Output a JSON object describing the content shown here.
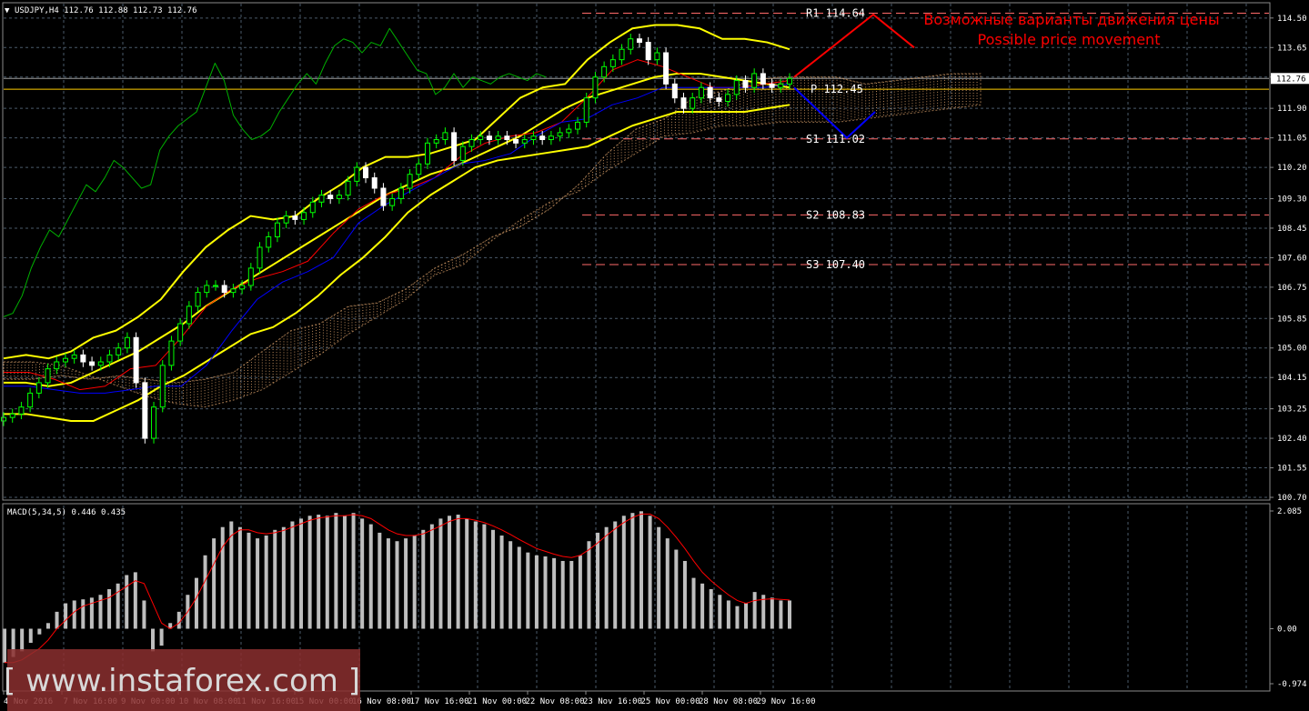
{
  "header": {
    "symbol_line": "USDJPY,H4  112.76 112.88 112.73 112.76",
    "macd_line": "MACD(5,34,5) 0.446 0.435"
  },
  "colors": {
    "background": "#000000",
    "grid": "#4a5a6a",
    "bull": "#00ff00",
    "bear": "#ffffff",
    "bollinger": "#ffff00",
    "tenkan": "#ff0000",
    "kijun": "#0000ff",
    "chikou": "#00b000",
    "cloud": "#d9a06a",
    "pivot": "#ffcc00",
    "levels": "#ff6a6a",
    "macd_hist": "#bebebe",
    "macd_signal": "#ff0000",
    "watermark_bg": "#8b2f2f"
  },
  "watermark": {
    "text": "[ www.instaforex.com ]"
  },
  "chart_data": [
    {
      "type": "candlestick",
      "symbol": "USDJPY",
      "timeframe": "H4",
      "ylim": [
        100.7,
        114.6
      ],
      "yticks": [
        "114.50",
        "113.65",
        "112.80",
        "111.90",
        "111.05",
        "110.20",
        "109.30",
        "108.45",
        "107.60",
        "106.75",
        "105.85",
        "105.00",
        "104.15",
        "103.25",
        "102.40",
        "101.55",
        "100.70"
      ],
      "current_price": "112.76",
      "x_labels": [
        "4 Nov 2016",
        "7 Nov 16:00",
        "9 Nov 00:00",
        "10 Nov 08:00",
        "11 Nov 16:00",
        "15 Nov 00:00",
        "16 Nov 08:00",
        "17 Nov 16:00",
        "21 Nov 00:00",
        "22 Nov 08:00",
        "23 Nov 16:00",
        "25 Nov 00:00",
        "28 Nov 08:00",
        "29 Nov 16:00"
      ],
      "close": [
        103.0,
        103.1,
        103.3,
        103.7,
        104.0,
        104.4,
        104.6,
        104.7,
        104.8,
        104.6,
        104.5,
        104.6,
        104.8,
        105.0,
        105.3,
        104.0,
        102.4,
        103.3,
        104.5,
        105.2,
        105.7,
        106.2,
        106.6,
        106.8,
        106.8,
        106.6,
        106.7,
        106.8,
        107.3,
        107.9,
        108.2,
        108.6,
        108.8,
        108.7,
        108.9,
        109.2,
        109.4,
        109.3,
        109.4,
        109.8,
        110.2,
        109.9,
        109.6,
        109.1,
        109.3,
        109.6,
        110.0,
        110.3,
        110.9,
        111.0,
        111.2,
        110.4,
        110.8,
        111.0,
        111.1,
        111.0,
        111.1,
        111.0,
        110.9,
        111.0,
        111.1,
        111.0,
        111.1,
        111.2,
        111.3,
        111.5,
        112.2,
        112.8,
        113.1,
        113.3,
        113.6,
        113.9,
        113.8,
        113.3,
        113.5,
        112.6,
        112.2,
        111.9,
        112.2,
        112.5,
        112.2,
        112.1,
        112.3,
        112.7,
        112.5,
        112.9,
        112.6,
        112.5,
        112.6,
        112.76
      ],
      "chikou": [
        105.9,
        106.0,
        106.5,
        107.3,
        107.9,
        108.4,
        108.2,
        108.7,
        109.2,
        109.7,
        109.5,
        109.9,
        110.4,
        110.2,
        109.9,
        109.6,
        109.7,
        110.7,
        111.1,
        111.4,
        111.6,
        111.8,
        112.5,
        113.2,
        112.7,
        111.7,
        111.3,
        111.0,
        111.1,
        111.3,
        111.8,
        112.2,
        112.6,
        112.9,
        112.6,
        113.2,
        113.7,
        113.9,
        113.8,
        113.5,
        113.8,
        113.7,
        114.2,
        113.8,
        113.4,
        113.0,
        112.9,
        112.3,
        112.5,
        112.9,
        112.5,
        112.8,
        112.7,
        112.6,
        112.8,
        112.9,
        112.8,
        112.7,
        112.9,
        112.8
      ],
      "bollinger_upper": [
        104.7,
        104.8,
        104.7,
        104.9,
        105.3,
        105.5,
        105.9,
        106.4,
        107.2,
        107.9,
        108.4,
        108.8,
        108.7,
        108.8,
        109.3,
        109.7,
        110.2,
        110.5,
        110.5,
        110.6,
        110.8,
        111.0,
        111.6,
        112.2,
        112.5,
        112.6,
        113.3,
        113.8,
        114.2,
        114.3,
        114.3,
        114.2,
        113.9,
        113.9,
        113.8,
        113.6
      ],
      "bollinger_middle": [
        104.0,
        104.0,
        103.9,
        104.0,
        104.3,
        104.6,
        104.9,
        105.3,
        105.7,
        106.2,
        106.6,
        107.0,
        107.4,
        107.8,
        108.2,
        108.6,
        109.0,
        109.4,
        109.7,
        110.0,
        110.2,
        110.5,
        110.8,
        111.1,
        111.5,
        111.9,
        112.2,
        112.4,
        112.6,
        112.8,
        112.9,
        112.9,
        112.8,
        112.7,
        112.6,
        112.5
      ],
      "bollinger_lower": [
        103.1,
        103.1,
        103.0,
        102.9,
        102.9,
        103.2,
        103.5,
        103.9,
        104.2,
        104.6,
        105.0,
        105.4,
        105.6,
        106.0,
        106.5,
        107.1,
        107.6,
        108.2,
        108.9,
        109.4,
        109.8,
        110.2,
        110.4,
        110.5,
        110.6,
        110.7,
        110.8,
        111.1,
        111.4,
        111.6,
        111.8,
        111.8,
        111.8,
        111.8,
        111.9,
        112.0
      ],
      "tenkan": [
        104.3,
        104.3,
        104.1,
        103.8,
        103.9,
        104.4,
        104.5,
        105.3,
        106.2,
        106.7,
        107.0,
        107.2,
        107.5,
        108.3,
        109.0,
        109.4,
        109.6,
        109.9,
        110.5,
        110.9,
        111.1,
        111.2,
        111.5,
        112.2,
        113.0,
        113.3,
        113.1,
        112.8,
        112.5,
        112.5,
        112.6,
        112.7
      ],
      "kijun": [
        103.9,
        103.9,
        103.8,
        103.7,
        103.7,
        103.8,
        103.9,
        103.9,
        104.5,
        105.5,
        106.4,
        106.9,
        107.2,
        107.6,
        108.6,
        109.1,
        109.5,
        109.9,
        110.3,
        110.4,
        110.6,
        111.1,
        111.5,
        111.6,
        112.0,
        112.2,
        112.5,
        112.5,
        112.5,
        112.5,
        112.5,
        112.6
      ],
      "cloud_a": [
        104.1,
        104.1,
        104.2,
        104.1,
        104.2,
        104.1,
        104.0,
        104.1,
        104.3,
        104.9,
        105.5,
        105.7,
        106.2,
        106.3,
        106.7,
        107.3,
        107.7,
        108.2,
        108.5,
        109.0,
        109.7,
        110.6,
        111.3,
        111.6,
        112.2,
        112.4,
        112.7,
        112.8,
        112.8,
        112.8,
        112.6,
        112.7,
        112.8,
        112.9,
        112.9
      ],
      "cloud_b": [
        104.6,
        104.6,
        104.5,
        104.2,
        103.9,
        103.6,
        103.4,
        103.3,
        103.5,
        103.8,
        104.3,
        104.8,
        105.4,
        105.9,
        106.4,
        107.1,
        107.4,
        108.1,
        108.7,
        109.2,
        109.5,
        110.1,
        110.6,
        111.1,
        111.2,
        111.4,
        111.4,
        111.5,
        111.5,
        111.5,
        111.6,
        111.7,
        111.8,
        111.9,
        112.0
      ],
      "levels": [
        {
          "label": "R1",
          "value": "114.64"
        },
        {
          "label": "P",
          "value": "112.45"
        },
        {
          "label": "S1",
          "value": "111.02"
        },
        {
          "label": "S2",
          "value": "108.83"
        },
        {
          "label": "S3",
          "value": "107.40"
        }
      ],
      "annotations": [
        "Возможные варианты движения цены",
        "Possible price movement"
      ],
      "scenario_up": [
        [
          112.8,
          112.8
        ],
        [
          114.6,
          114.6
        ],
        [
          113.65,
          113.65
        ]
      ],
      "scenario_down": [
        [
          112.5,
          112.5
        ],
        [
          111.05,
          111.05
        ],
        [
          111.8,
          111.8
        ]
      ]
    },
    {
      "type": "bar",
      "title": "MACD(5,34,5) 0.446 0.435",
      "ylim": [
        -0.974,
        2.085
      ],
      "yticks": [
        "2.085",
        "0.00",
        "-0.974"
      ],
      "values": [
        -0.6,
        -0.5,
        -0.4,
        -0.25,
        -0.1,
        0.1,
        0.3,
        0.45,
        0.5,
        0.52,
        0.55,
        0.6,
        0.7,
        0.8,
        0.95,
        1.0,
        0.5,
        -0.4,
        -0.3,
        0.1,
        0.3,
        0.6,
        0.9,
        1.3,
        1.6,
        1.8,
        1.9,
        1.8,
        1.7,
        1.6,
        1.65,
        1.75,
        1.8,
        1.9,
        1.95,
        2.0,
        2.02,
        2.0,
        2.05,
        2.0,
        2.05,
        1.95,
        1.85,
        1.7,
        1.6,
        1.55,
        1.6,
        1.65,
        1.75,
        1.85,
        1.95,
        2.0,
        2.02,
        1.95,
        1.9,
        1.85,
        1.75,
        1.65,
        1.55,
        1.45,
        1.35,
        1.3,
        1.28,
        1.25,
        1.2,
        1.2,
        1.3,
        1.55,
        1.7,
        1.8,
        1.9,
        2.0,
        2.05,
        2.08,
        2.0,
        1.8,
        1.6,
        1.4,
        1.2,
        0.9,
        0.8,
        0.7,
        0.6,
        0.5,
        0.4,
        0.45,
        0.65,
        0.6,
        0.55,
        0.5,
        0.5
      ],
      "signal": [
        -0.6,
        -0.6,
        -0.55,
        -0.45,
        -0.35,
        -0.2,
        0.0,
        0.15,
        0.3,
        0.4,
        0.45,
        0.5,
        0.55,
        0.65,
        0.75,
        0.85,
        0.8,
        0.45,
        0.1,
        0.0,
        0.1,
        0.3,
        0.55,
        0.85,
        1.15,
        1.45,
        1.65,
        1.75,
        1.75,
        1.7,
        1.68,
        1.7,
        1.74,
        1.8,
        1.86,
        1.92,
        1.96,
        1.98,
        2.0,
        2.0,
        2.02,
        2.0,
        1.95,
        1.85,
        1.75,
        1.68,
        1.65,
        1.65,
        1.68,
        1.75,
        1.82,
        1.9,
        1.95,
        1.95,
        1.92,
        1.88,
        1.82,
        1.75,
        1.67,
        1.58,
        1.5,
        1.42,
        1.37,
        1.32,
        1.28,
        1.26,
        1.3,
        1.4,
        1.52,
        1.65,
        1.77,
        1.88,
        1.97,
        2.03,
        2.03,
        1.95,
        1.8,
        1.62,
        1.42,
        1.2,
        1.0,
        0.85,
        0.72,
        0.6,
        0.5,
        0.45,
        0.5,
        0.52,
        0.53,
        0.52,
        0.51
      ]
    }
  ]
}
